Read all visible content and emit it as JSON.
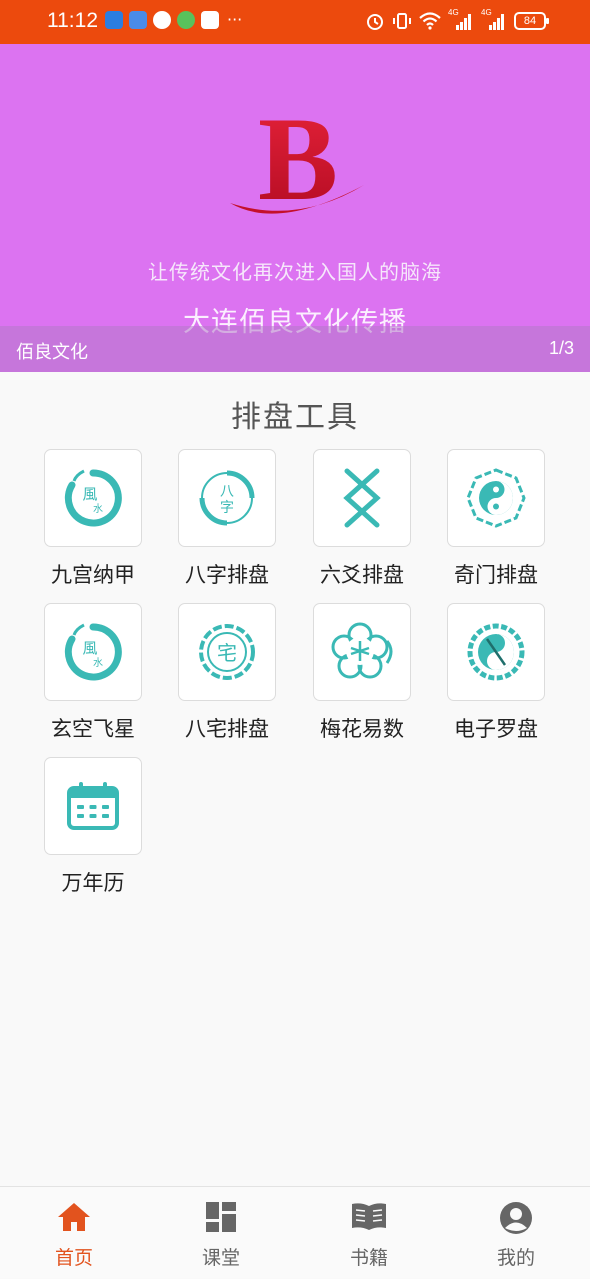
{
  "status_bar": {
    "time": "11:12",
    "battery": "84",
    "more": "···",
    "network_1": "4G",
    "network_2": "4G"
  },
  "banner": {
    "logo_letter": "B",
    "slogan": "让传统文化再次进入国人的脑海",
    "company": "大连佰良文化传播",
    "caption": "佰良文化",
    "pager": "1/3"
  },
  "section": {
    "title": "排盘工具"
  },
  "tools": [
    {
      "label": "九宫纳甲",
      "icon": "fengshui-icon"
    },
    {
      "label": "八字排盘",
      "icon": "bazi-icon"
    },
    {
      "label": "六爻排盘",
      "icon": "liuyao-icon"
    },
    {
      "label": "奇门排盘",
      "icon": "yinyang-bagua-icon"
    },
    {
      "label": "玄空飞星",
      "icon": "fengshui-icon"
    },
    {
      "label": "八宅排盘",
      "icon": "zhai-icon"
    },
    {
      "label": "梅花易数",
      "icon": "plum-blossom-icon"
    },
    {
      "label": "电子罗盘",
      "icon": "compass-icon"
    },
    {
      "label": "万年历",
      "icon": "calendar-icon"
    }
  ],
  "tabbar": {
    "items": [
      {
        "label": "首页",
        "icon": "home-icon",
        "active": true
      },
      {
        "label": "课堂",
        "icon": "dashboard-icon",
        "active": false
      },
      {
        "label": "书籍",
        "icon": "book-icon",
        "active": false
      },
      {
        "label": "我的",
        "icon": "profile-icon",
        "active": false
      }
    ]
  },
  "colors": {
    "status_bar": "#ec4a0d",
    "banner_bg": "#dc73f1",
    "icon_teal": "#3ab9b5",
    "tab_active": "#e2531e"
  }
}
